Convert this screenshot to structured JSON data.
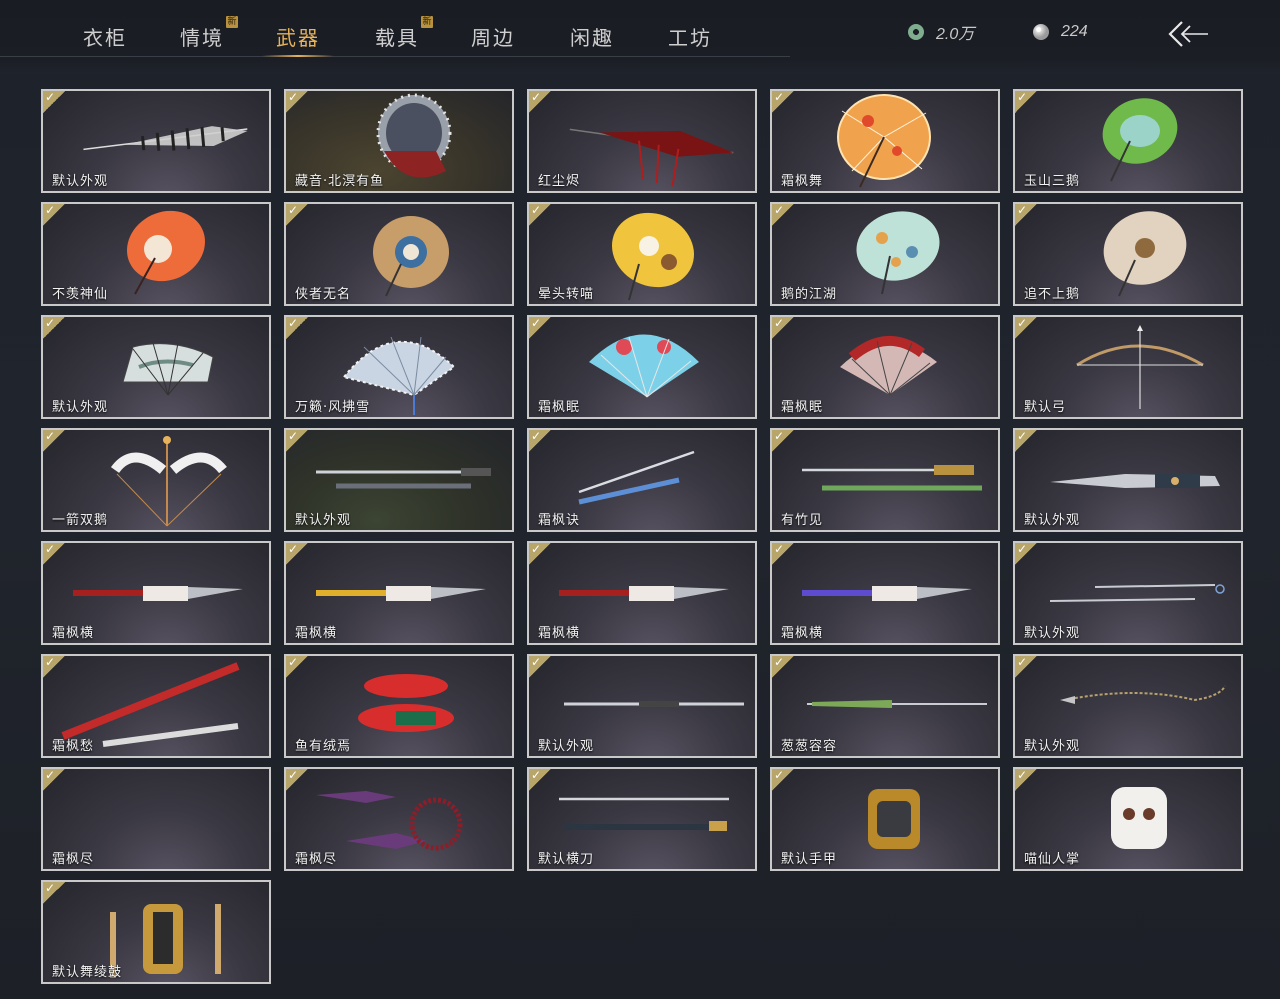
{
  "tabs": [
    {
      "label": "衣柜",
      "new": false
    },
    {
      "label": "情境",
      "new": true
    },
    {
      "label": "武器",
      "new": false,
      "active": true
    },
    {
      "label": "载具",
      "new": true
    },
    {
      "label": "周边",
      "new": false
    },
    {
      "label": "闲趣",
      "new": false
    },
    {
      "label": "工坊",
      "new": false
    }
  ],
  "new_badge": "新",
  "currency": {
    "jade": {
      "icon": "jade-coin-icon",
      "value": "2.0万"
    },
    "pearl": {
      "icon": "pearl-icon",
      "value": "224"
    }
  },
  "colors": {
    "accent": "#e7b25a",
    "card_border": "#c9c9c9",
    "check": "#b8a56a"
  },
  "items": [
    {
      "label": "默认外观",
      "icon": "closed-umbrella-icon",
      "owned": true
    },
    {
      "label": "藏音·北溟有鱼",
      "icon": "spiked-umbrella-icon",
      "owned": true
    },
    {
      "label": "红尘烬",
      "icon": "red-closed-umbrella-icon",
      "owned": true
    },
    {
      "label": "霜枫舞",
      "icon": "orange-umbrella-icon",
      "owned": true
    },
    {
      "label": "玉山三鹅",
      "icon": "green-umbrella-icon",
      "owned": true
    },
    {
      "label": "不羡神仙",
      "icon": "red-umbrella-icon",
      "owned": true
    },
    {
      "label": "侠者无名",
      "icon": "patterned-umbrella-icon",
      "owned": true
    },
    {
      "label": "晕头转喵",
      "icon": "yellow-umbrella-icon",
      "owned": true
    },
    {
      "label": "鹅的江湖",
      "icon": "floral-umbrella-icon",
      "owned": true
    },
    {
      "label": "追不上鹅",
      "icon": "beige-umbrella-icon",
      "owned": true
    },
    {
      "label": "默认外观",
      "icon": "folding-fan-icon",
      "owned": true
    },
    {
      "label": "万籁·风拂雪",
      "icon": "lace-fan-icon",
      "owned": true
    },
    {
      "label": "霜枫眠",
      "icon": "blue-fan-icon",
      "owned": true
    },
    {
      "label": "霜枫眠",
      "icon": "red-fan-icon",
      "owned": true
    },
    {
      "label": "默认弓",
      "icon": "bow-icon",
      "owned": true
    },
    {
      "label": "一箭双鹅",
      "icon": "white-bow-icon",
      "owned": true
    },
    {
      "label": "默认外观",
      "icon": "sword-icon",
      "owned": true
    },
    {
      "label": "霜枫诀",
      "icon": "blue-sword-icon",
      "owned": true
    },
    {
      "label": "有竹见",
      "icon": "bamboo-sword-icon",
      "owned": true
    },
    {
      "label": "默认外观",
      "icon": "twin-blade-icon",
      "owned": true
    },
    {
      "label": "霜枫横",
      "icon": "red-spear-icon",
      "owned": true
    },
    {
      "label": "霜枫横",
      "icon": "yellow-spear-icon",
      "owned": true
    },
    {
      "label": "霜枫横",
      "icon": "red-spear-icon",
      "owned": true
    },
    {
      "label": "霜枫横",
      "icon": "purple-spear-icon",
      "owned": true
    },
    {
      "label": "默认外观",
      "icon": "dual-sabre-icon",
      "owned": true
    },
    {
      "label": "霜枫愁",
      "icon": "red-staff-icon",
      "owned": true
    },
    {
      "label": "鱼有绒焉",
      "icon": "red-fish-icon",
      "owned": true
    },
    {
      "label": "默认外观",
      "icon": "long-blade-icon",
      "owned": true
    },
    {
      "label": "葱葱容容",
      "icon": "scallion-icon",
      "owned": true
    },
    {
      "label": "默认外观",
      "icon": "rope-dart-icon",
      "owned": true
    },
    {
      "label": "霜枫尽",
      "icon": "empty-icon",
      "owned": true
    },
    {
      "label": "霜枫尽",
      "icon": "bead-dart-icon",
      "owned": true
    },
    {
      "label": "默认横刀",
      "icon": "saber-icon",
      "owned": true
    },
    {
      "label": "默认手甲",
      "icon": "gauntlet-icon",
      "owned": true
    },
    {
      "label": "喵仙人掌",
      "icon": "cat-paw-icon",
      "owned": true
    },
    {
      "label": "默认舞绫鼓",
      "icon": "drum-icon",
      "owned": true
    }
  ]
}
